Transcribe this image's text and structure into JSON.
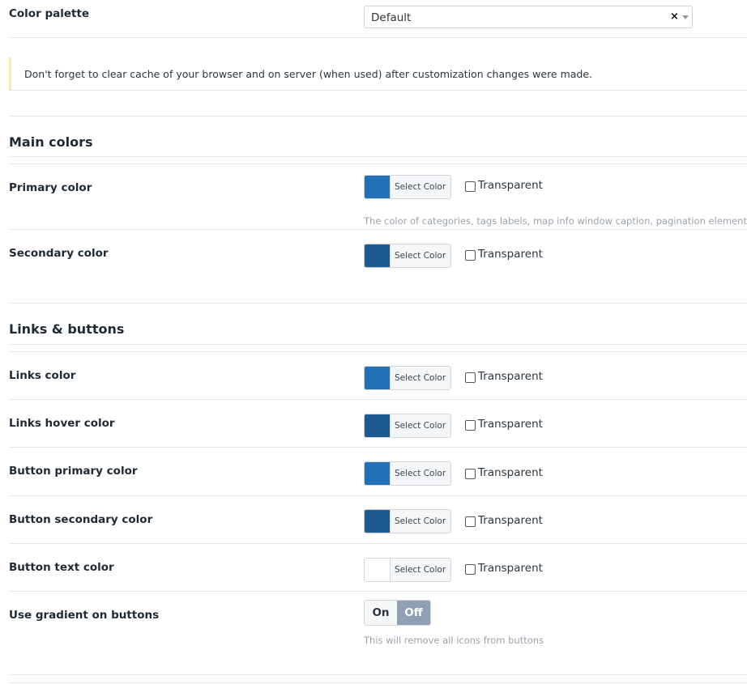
{
  "palette": {
    "label": "Color palette",
    "value": "Default",
    "clear_glyph": "×"
  },
  "notice": {
    "text": "Don't forget to clear cache of your browser and on server (when used) after customization changes were made."
  },
  "sections": {
    "main_colors": "Main colors",
    "links_buttons": "Links & buttons"
  },
  "common": {
    "select_color": "Select Color",
    "transparent": "Transparent"
  },
  "rows": {
    "primary": {
      "label": "Primary color",
      "color": "#2271b6",
      "hint": "The color of categories, tags labels, map info window caption, pagination elements"
    },
    "secondary": {
      "label": "Secondary color",
      "color": "#1d5a90"
    },
    "links": {
      "label": "Links color",
      "color": "#2271b6"
    },
    "links_hover": {
      "label": "Links hover color",
      "color": "#1d5a90"
    },
    "button_primary": {
      "label": "Button primary color",
      "color": "#2271b6"
    },
    "button_secondary": {
      "label": "Button secondary color",
      "color": "#1d5a90"
    },
    "button_text": {
      "label": "Button text color",
      "color": "#ffffff"
    }
  },
  "gradient": {
    "label": "Use gradient on buttons",
    "on_label": "On",
    "off_label": "Off",
    "active": "Off",
    "hint": "This will remove all icons from buttons"
  }
}
